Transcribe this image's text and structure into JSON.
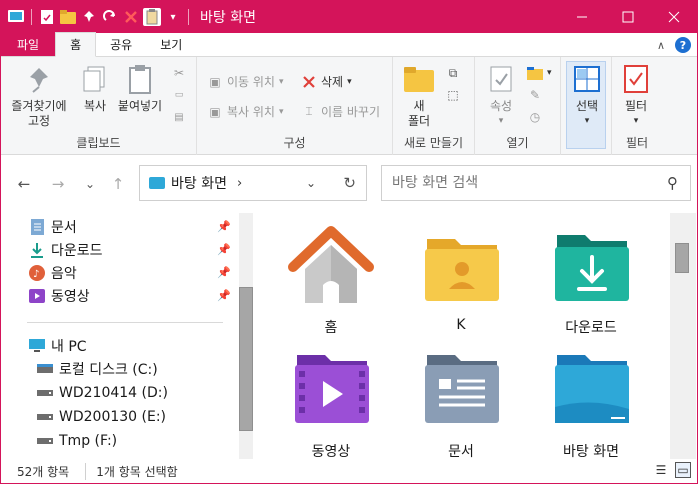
{
  "window": {
    "title": "바탕 화면",
    "accent": "#d4145a"
  },
  "menu": {
    "tabs": [
      "파일",
      "홈",
      "공유",
      "보기"
    ],
    "help_icon": "?"
  },
  "ribbon": {
    "clipboard": {
      "pin_label": "즐겨찾기에\n고정",
      "copy_label": "복사",
      "paste_label": "붙여넣기",
      "group": "클립보드"
    },
    "organize": {
      "move_label": "이동 위치",
      "copy_to_label": "복사 위치",
      "delete_label": "삭제",
      "rename_label": "이름 바꾸기",
      "group": "구성"
    },
    "new": {
      "new_folder_label": "새\n폴더",
      "group": "새로 만들기"
    },
    "open": {
      "props_label": "속성",
      "group": "열기"
    },
    "select": {
      "select_label": "선택",
      "group": ""
    },
    "filter": {
      "filter_label": "필터",
      "group": "필터"
    }
  },
  "address": {
    "path": "바탕 화면",
    "search_placeholder": "바탕 화면 검색"
  },
  "sidebar": {
    "quick": [
      {
        "label": "문서",
        "icon": "document-icon"
      },
      {
        "label": "다운로드",
        "icon": "download-icon"
      },
      {
        "label": "음악",
        "icon": "music-icon"
      },
      {
        "label": "동영상",
        "icon": "video-icon"
      }
    ],
    "pc_label": "내 PC",
    "drives": [
      {
        "label": "로컬 디스크 (C:)"
      },
      {
        "label": "WD210414 (D:)"
      },
      {
        "label": "WD200130 (E:)"
      },
      {
        "label": "Tmp (F:)"
      }
    ]
  },
  "items": [
    {
      "label": "홈",
      "icon": "home-icon"
    },
    {
      "label": "K",
      "icon": "user-folder-icon"
    },
    {
      "label": "다운로드",
      "icon": "downloads-folder-icon"
    },
    {
      "label": "동영상",
      "icon": "videos-folder-icon"
    },
    {
      "label": "문서",
      "icon": "documents-folder-icon"
    },
    {
      "label": "바탕 화면",
      "icon": "desktop-folder-icon"
    }
  ],
  "status": {
    "count": "52개 항목",
    "selected": "1개 항목 선택함"
  }
}
